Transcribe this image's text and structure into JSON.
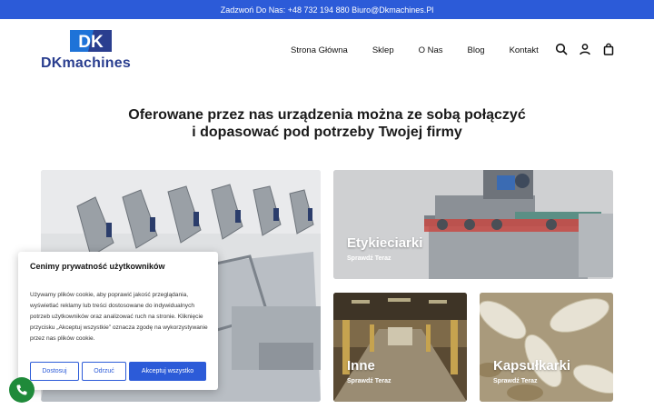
{
  "topbar": {
    "text": "Zadzwoń Do Nas: +48 732 194 880 Biuro@Dkmachines.Pl"
  },
  "header": {
    "logo_mark": "DK",
    "logo_text": "DKmachines",
    "nav": [
      "Strona Główna",
      "Sklep",
      "O Nas",
      "Blog",
      "Kontakt"
    ],
    "icons": [
      "search-icon",
      "account-icon",
      "cart-icon"
    ]
  },
  "headline": {
    "line1": "Oferowane przez nas urządzenia można ze sobą połączyć",
    "line2": "i dopasować pod potrzeby Twojej firmy"
  },
  "cards": {
    "labeling": {
      "title": "Etykieciarki",
      "sub": "Sprawdź Teraz"
    },
    "other": {
      "title": "Inne",
      "sub": "Sprawdź Teraz"
    },
    "capsule": {
      "title": "Kapsułkarki",
      "sub": "Sprawdź Teraz"
    }
  },
  "cookie": {
    "title": "Cenimy prywatność użytkowników",
    "text": "Używamy plików cookie, aby poprawić jakość przeglądania, wyświetlać reklamy lub treści dostosowane do indywidualnych potrzeb użytkowników oraz analizować ruch na stronie. Kliknięcie przycisku „Akceptuj wszystkie” oznacza zgodę na wykorzystywanie przez nas plików cookie.",
    "customize": "Dostosuj",
    "reject": "Odrzuć",
    "accept": "Akceptuj wszystko"
  },
  "colors": {
    "accent": "#2c5bd8",
    "logo_text": "#2a3e8f",
    "phone": "#1f8a3a"
  }
}
